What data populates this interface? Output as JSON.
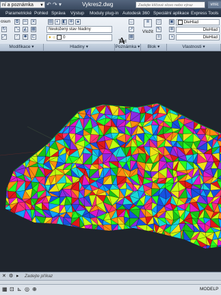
{
  "titlebar": {
    "workspace": "ní a poznámka",
    "document_title": "Vykres2.dwg",
    "search_placeholder": "Zadejte klíčové slovo nebo výraz",
    "user_label": "vmic"
  },
  "tabs": [
    {
      "label": "Parametrické"
    },
    {
      "label": "Pohled"
    },
    {
      "label": "Správa"
    },
    {
      "label": "Výstup"
    },
    {
      "label": "Moduly plug-in"
    },
    {
      "label": "Autodesk 360"
    },
    {
      "label": "Speciální aplikace"
    },
    {
      "label": "Express Tools"
    }
  ],
  "ribbon": {
    "move_label": "osun",
    "layer_state": "Neuložený stav hladiny",
    "layer_current": "0",
    "text_label": "Text",
    "insert_label": "Vložit",
    "color_value": "DleHlad",
    "linetype_value": "DleHlad",
    "lineweight_value": "DleHlad",
    "panels": {
      "modify": "Modifikace",
      "layers": "Hladiny",
      "annotation": "Poznámka",
      "block": "Blok",
      "properties": "Vlastnosti"
    }
  },
  "command": {
    "prompt": "Zadejte příkaz"
  },
  "status": {
    "model_label": "MODELP"
  },
  "colors": {
    "viewport_bg": "#1f252d",
    "ribbon_bg": "#dde4ed",
    "title_bg": "#3a4a60"
  }
}
